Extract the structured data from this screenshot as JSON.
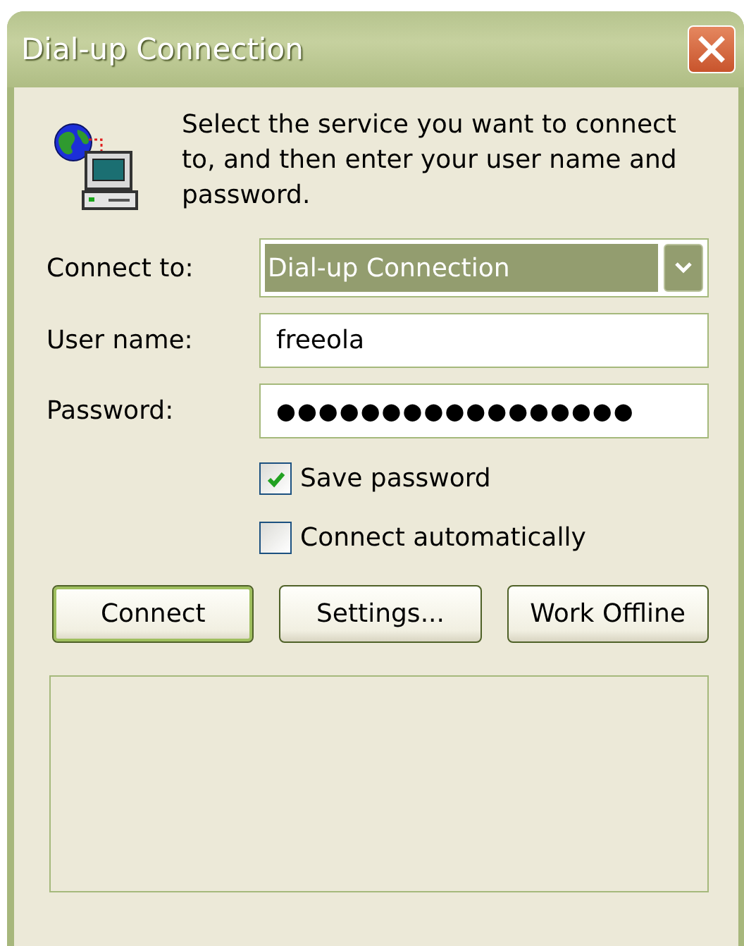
{
  "window": {
    "title": "Dial-up Connection"
  },
  "message": "Select the service you want to connect to, and then enter your user name and password.",
  "fields": [
    {
      "kind": "combo",
      "label": "Connect to:",
      "value": "Dial-up Connection"
    },
    {
      "kind": "text",
      "label": "User name:",
      "value": "freeola"
    },
    {
      "kind": "password",
      "label": "Password:",
      "value": "●●●●●●●●●●●●●●●●●"
    }
  ],
  "checkboxes": [
    {
      "label": "Save password",
      "checked": true
    },
    {
      "label": "Connect automatically",
      "checked": false
    }
  ],
  "buttons": [
    {
      "label": "Connect",
      "default": true
    },
    {
      "label": "Settings...",
      "default": false
    },
    {
      "label": "Work Offline",
      "default": false
    }
  ]
}
